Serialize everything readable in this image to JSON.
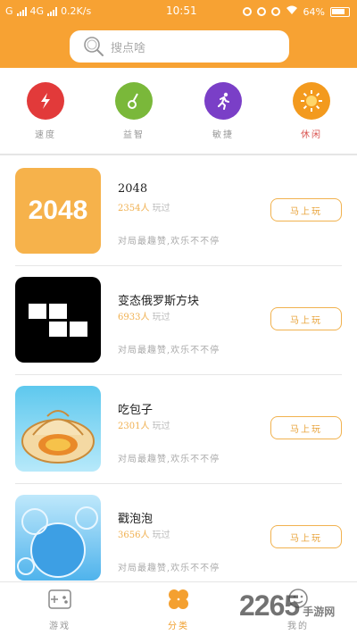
{
  "statusbar": {
    "carrier": "G",
    "network": "4G",
    "speed": "0.2K/s",
    "time": "10:51",
    "battery": "64%"
  },
  "search": {
    "placeholder": "搜点啥",
    "icon": "search-icon"
  },
  "categories": [
    {
      "label": "速度",
      "icon": "lightning-icon",
      "color": "#e23a3a",
      "active": false
    },
    {
      "label": "益智",
      "icon": "guitar-icon",
      "color": "#7ab83a",
      "active": false
    },
    {
      "label": "敏捷",
      "icon": "runner-icon",
      "color": "#7a3fc7",
      "active": false
    },
    {
      "label": "休闲",
      "icon": "sun-icon",
      "color": "#f39a1e",
      "active": true
    }
  ],
  "games": [
    {
      "name": "2048",
      "count": "2354人",
      "suffix": "玩过",
      "desc": "对局最趣赞,欢乐不不停",
      "button": "马上玩",
      "thumb_text": "2048"
    },
    {
      "name": "变态俄罗斯方块",
      "count": "6933人",
      "suffix": "玩过",
      "desc": "对局最趣赞,欢乐不不停",
      "button": "马上玩"
    },
    {
      "name": "吃包子",
      "count": "2301人",
      "suffix": "玩过",
      "desc": "对局最趣赞,欢乐不不停",
      "button": "马上玩"
    },
    {
      "name": "戳泡泡",
      "count": "3656人",
      "suffix": "玩过",
      "desc": "对局最趣赞,欢乐不不停",
      "button": "马上玩"
    }
  ],
  "nav": [
    {
      "label": "游戏",
      "icon": "gamepad-icon",
      "active": false
    },
    {
      "label": "分类",
      "icon": "clover-icon",
      "active": true
    },
    {
      "label": "我的",
      "icon": "profile-icon",
      "active": false
    }
  ],
  "watermark": {
    "main": "2265",
    "sub": "手游网"
  },
  "colors": {
    "accent": "#f7a233",
    "active_tab": "#f0a030",
    "play_button": "#f1b24f"
  }
}
